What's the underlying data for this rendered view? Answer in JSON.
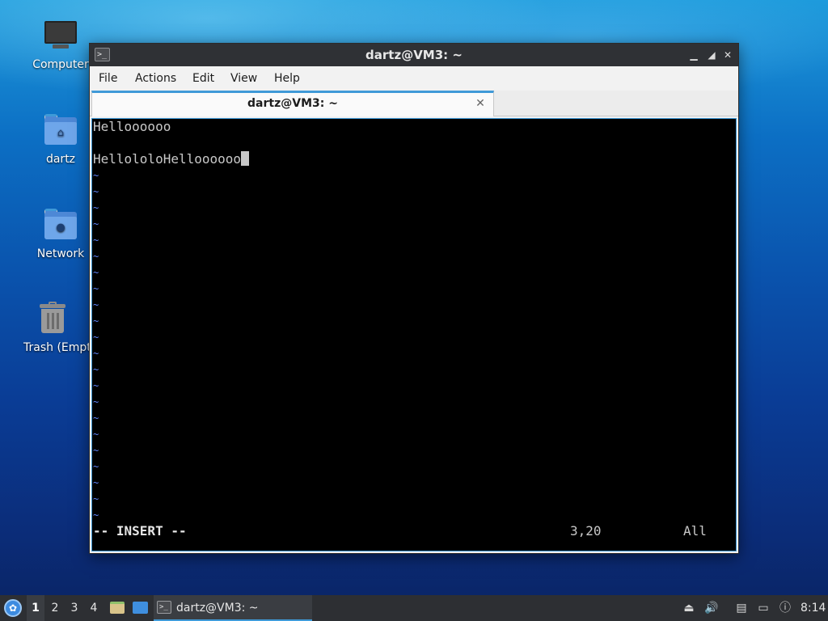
{
  "desktop": {
    "icons": [
      {
        "label": "Computer",
        "icon": "computer-icon"
      },
      {
        "label": "dartz",
        "icon": "home-folder-icon"
      },
      {
        "label": "Network",
        "icon": "network-folder-icon"
      },
      {
        "label": "Trash (Empt",
        "icon": "trash-icon"
      }
    ]
  },
  "window": {
    "title": "dartz@VM3: ~",
    "controls": {
      "minimize": "▁",
      "maximize": "◢",
      "close": "✕"
    },
    "menu": [
      "File",
      "Actions",
      "Edit",
      "View",
      "Help"
    ],
    "tab": {
      "label": "dartz@VM3: ~",
      "close": "✕"
    }
  },
  "terminal": {
    "lines": [
      "Helloooooo",
      "",
      "HellololoHelloooooo"
    ],
    "empty_line_marker": "~",
    "mode": "-- INSERT --",
    "position": "3,20",
    "scroll": "All",
    "colors": {
      "background": "#000000",
      "text": "#c8c8c8",
      "tilde": "#5f87ff"
    }
  },
  "taskbar": {
    "workspaces": [
      "1",
      "2",
      "3",
      "4"
    ],
    "active_workspace": "1",
    "task_label": "dartz@VM3: ~",
    "clock": "8:14",
    "accent": "#3f9ad8"
  }
}
